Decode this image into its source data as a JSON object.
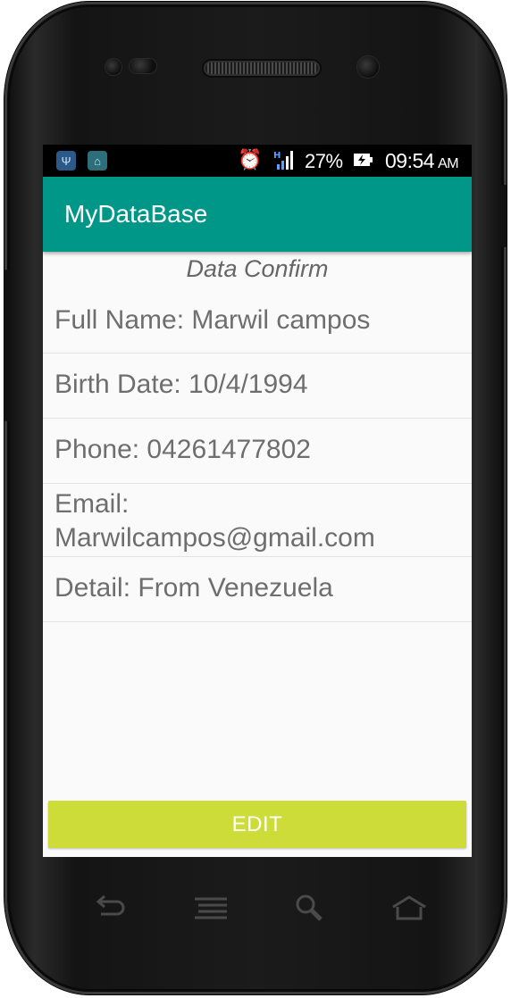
{
  "status_bar": {
    "battery_percent": "27%",
    "time": "09:54",
    "ampm": "AM",
    "icons": [
      "usb-icon",
      "android-debug-icon",
      "alarm-icon",
      "signal-h-icon",
      "battery-charging-icon"
    ]
  },
  "app_bar": {
    "title": "MyDataBase"
  },
  "content": {
    "subtitle": "Data Confirm",
    "fields": {
      "full_name": "Full Name: Marwil campos",
      "birth_date": "Birth Date: 10/4/1994",
      "phone": "Phone: 04261477802",
      "email_label": "Email:",
      "email_value": "Marwilcampos@gmail.com",
      "detail": "Detail: From Venezuela"
    },
    "edit_label": "EDIT"
  },
  "nav_buttons": [
    "back-icon",
    "menu-icon",
    "search-icon",
    "home-icon"
  ],
  "colors": {
    "app_bar": "#009688",
    "edit_button": "#cddc39",
    "text": "#6e6e6e",
    "background": "#fafafa"
  }
}
